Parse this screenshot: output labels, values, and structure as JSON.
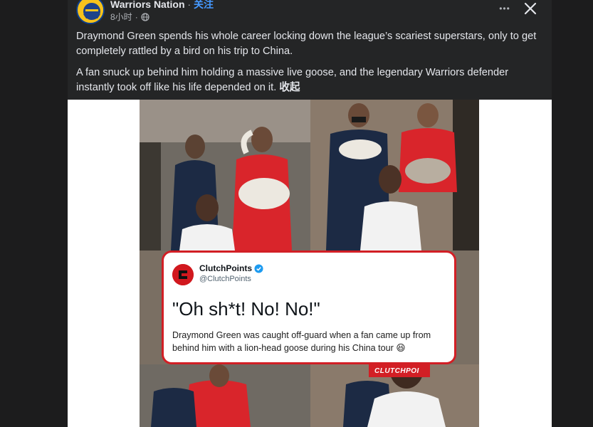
{
  "post": {
    "page_name": "Warriors Nation",
    "separator": " · ",
    "follow_label": "关注",
    "time": "8小时",
    "more_label": "•••",
    "paragraph_1": "Draymond Green spends his whole career locking down the league’s scariest superstars, only to get completely rattled by a bird on his trip to China.",
    "paragraph_2": "A fan snuck up behind him holding a massive live goose, and the legendary Warriors defender instantly took off like his life depended on it. ",
    "collapse_label": "收起",
    "icons": [
      "team-logo",
      "globe-icon",
      "more-icon",
      "close-icon"
    ]
  },
  "media": {
    "tweet": {
      "author": "ClutchPoints",
      "handle": "@ClutchPoints",
      "quote": "\"Oh sh*t! No! No!\"",
      "body": "Draymond Green was caught off-guard when a fan came up from behind him with a lion-head goose during his China tour ",
      "emoji": "😆"
    },
    "watermark": "CLUTCHPOI"
  },
  "colors": {
    "background": "#1c1c1d",
    "card": "#242526",
    "link": "#4599ff",
    "tweet_border": "#d21f25"
  }
}
